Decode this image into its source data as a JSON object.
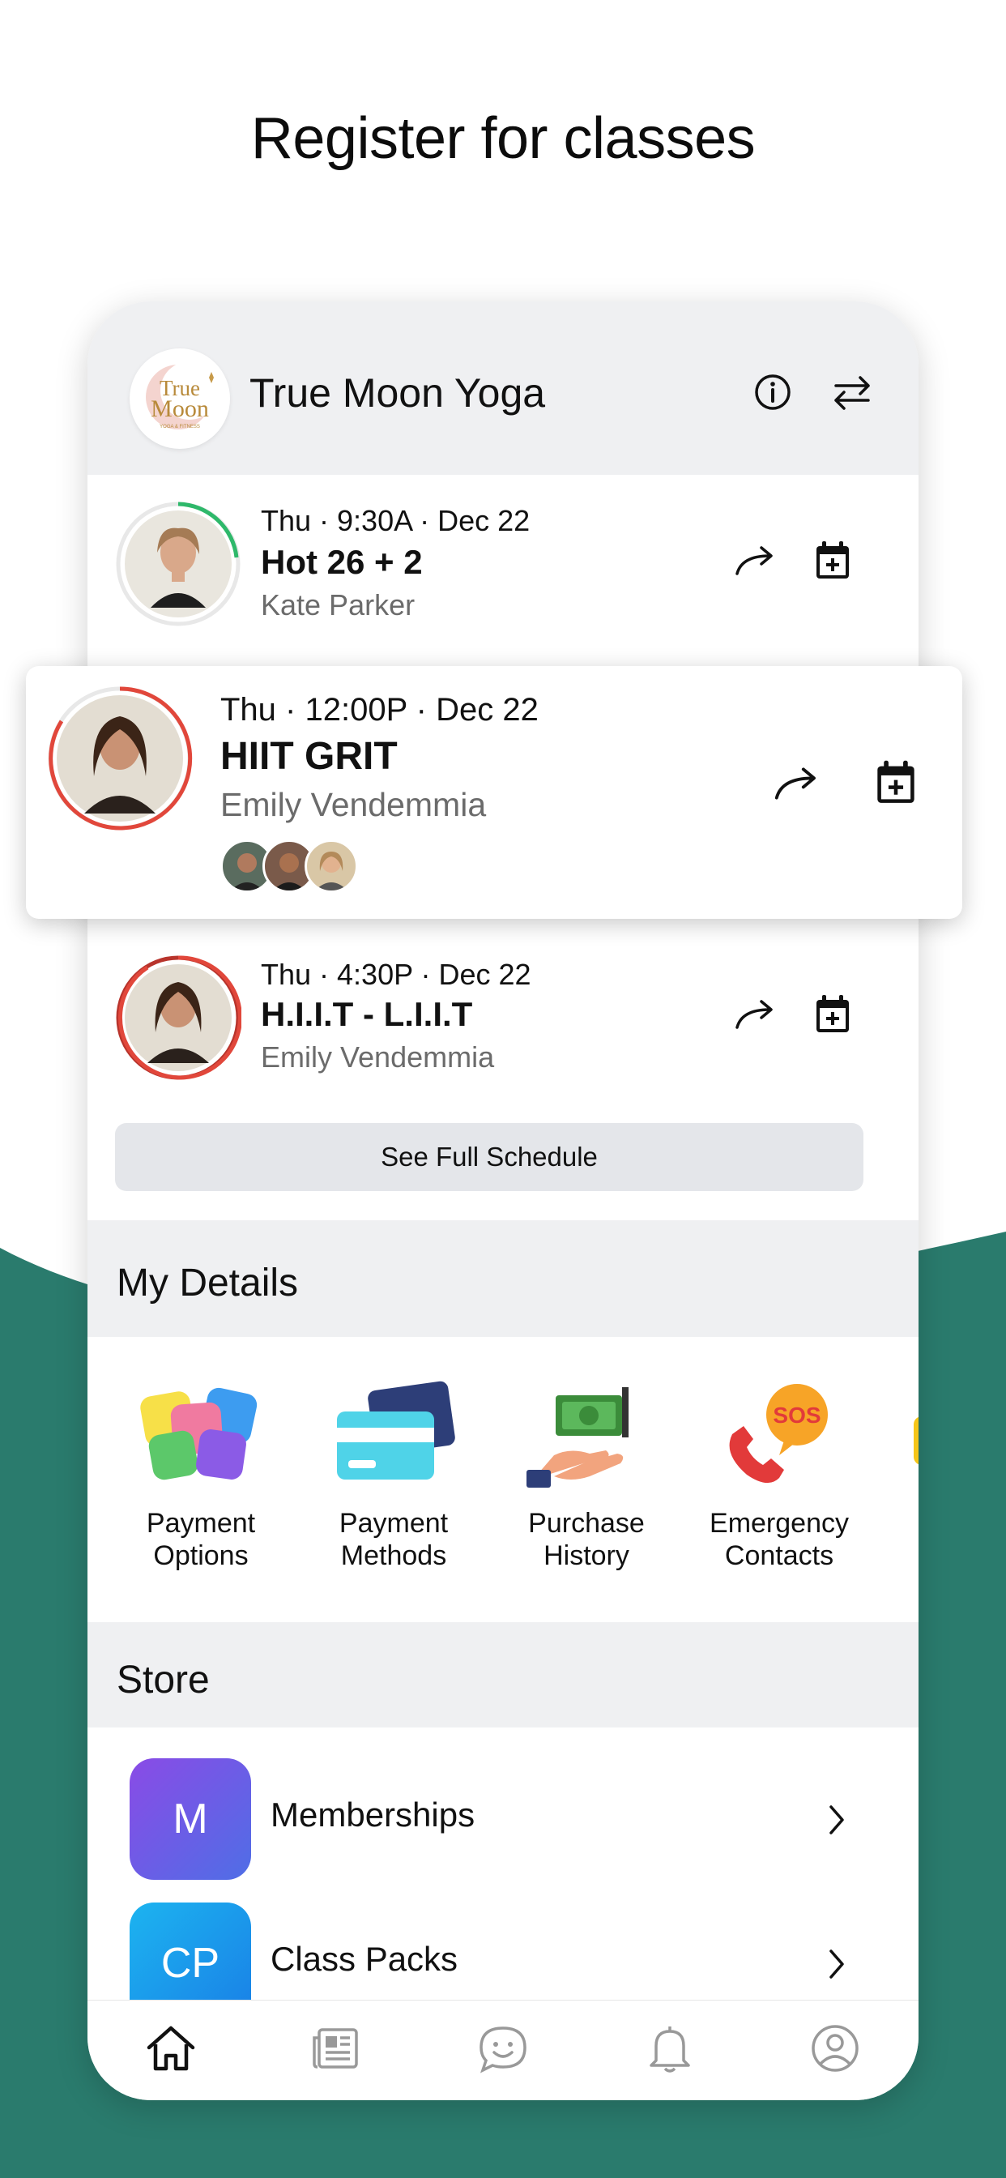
{
  "headline": "Register for classes",
  "colors": {
    "brand_green": "#2a7b6d",
    "ring_green": "#2eb86a",
    "ring_red": "#e1473b",
    "header_bg": "#eff0f2",
    "memberships_tile": "#6c4ee6",
    "class_packs_tile": "#1ca0f0"
  },
  "app": {
    "studio_name": "True Moon Yoga",
    "logo_text_line1": "True",
    "logo_text_line2": "Moon",
    "header_icons": [
      "info-icon",
      "switch-icon"
    ]
  },
  "classes": [
    {
      "time": "Thu · 9:30A · Dec 22",
      "name": "Hot 26 + 2",
      "instructor": "Kate Parker",
      "ring_color": "green",
      "attendee_count": 0
    },
    {
      "time": "Thu · 12:00P · Dec 22",
      "name": "HIIT GRIT",
      "instructor": "Emily Vendemmia",
      "ring_color": "red",
      "attendee_count": 3
    },
    {
      "time": "Thu · 4:30P · Dec 22",
      "name": "H.I.I.T - L.I.I.T",
      "instructor": "Emily Vendemmia",
      "ring_color": "red",
      "attendee_count": 0
    }
  ],
  "class_actions": [
    "share-icon",
    "add-to-calendar-icon"
  ],
  "see_full_schedule": "See Full Schedule",
  "my_details": {
    "title": "My Details",
    "items": [
      {
        "line1": "Payment",
        "line2": "Options",
        "icon": "payment-options-icon"
      },
      {
        "line1": "Payment",
        "line2": "Methods",
        "icon": "credit-cards-icon"
      },
      {
        "line1": "Purchase",
        "line2": "History",
        "icon": "money-hand-icon"
      },
      {
        "line1": "Emergency",
        "line2": "Contacts",
        "icon": "sos-phone-icon"
      }
    ]
  },
  "store": {
    "title": "Store",
    "items": [
      {
        "initials": "M",
        "label": "Memberships"
      },
      {
        "initials": "CP",
        "label": "Class Packs"
      }
    ]
  },
  "tabbar": [
    "home-icon",
    "news-icon",
    "chat-icon",
    "bell-icon",
    "profile-icon"
  ],
  "active_tab": "home-icon"
}
